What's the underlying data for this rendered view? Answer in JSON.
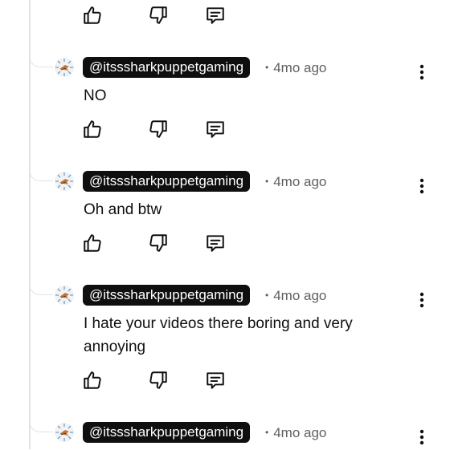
{
  "replies": [
    {
      "author": "@itsssharkpuppetgaming",
      "time": "4mo ago",
      "text": "NO",
      "avatar_icon": "shark-avatar-icon",
      "menu_icon": "more-vert-icon"
    },
    {
      "author": "@itsssharkpuppetgaming",
      "time": "4mo ago",
      "text": "Oh and btw",
      "avatar_icon": "shark-avatar-icon",
      "menu_icon": "more-vert-icon"
    },
    {
      "author": "@itsssharkpuppetgaming",
      "time": "4mo ago",
      "text": "I hate your videos there boring and very annoying",
      "avatar_icon": "shark-avatar-icon",
      "menu_icon": "more-vert-icon"
    },
    {
      "author": "@itsssharkpuppetgaming",
      "time": "4mo ago",
      "text": "",
      "avatar_icon": "shark-avatar-icon",
      "menu_icon": "more-vert-icon"
    }
  ],
  "meta_separator": "•",
  "action_icons": [
    "thumb-up-icon",
    "thumb-down-icon",
    "reply-comment-icon"
  ],
  "colors": {
    "text": "#0f0f0f",
    "secondary_text": "#606060",
    "author_chip_bg": "#0f0f0f",
    "author_chip_text": "#ffffff",
    "thread_line": "#e2e2e2"
  }
}
